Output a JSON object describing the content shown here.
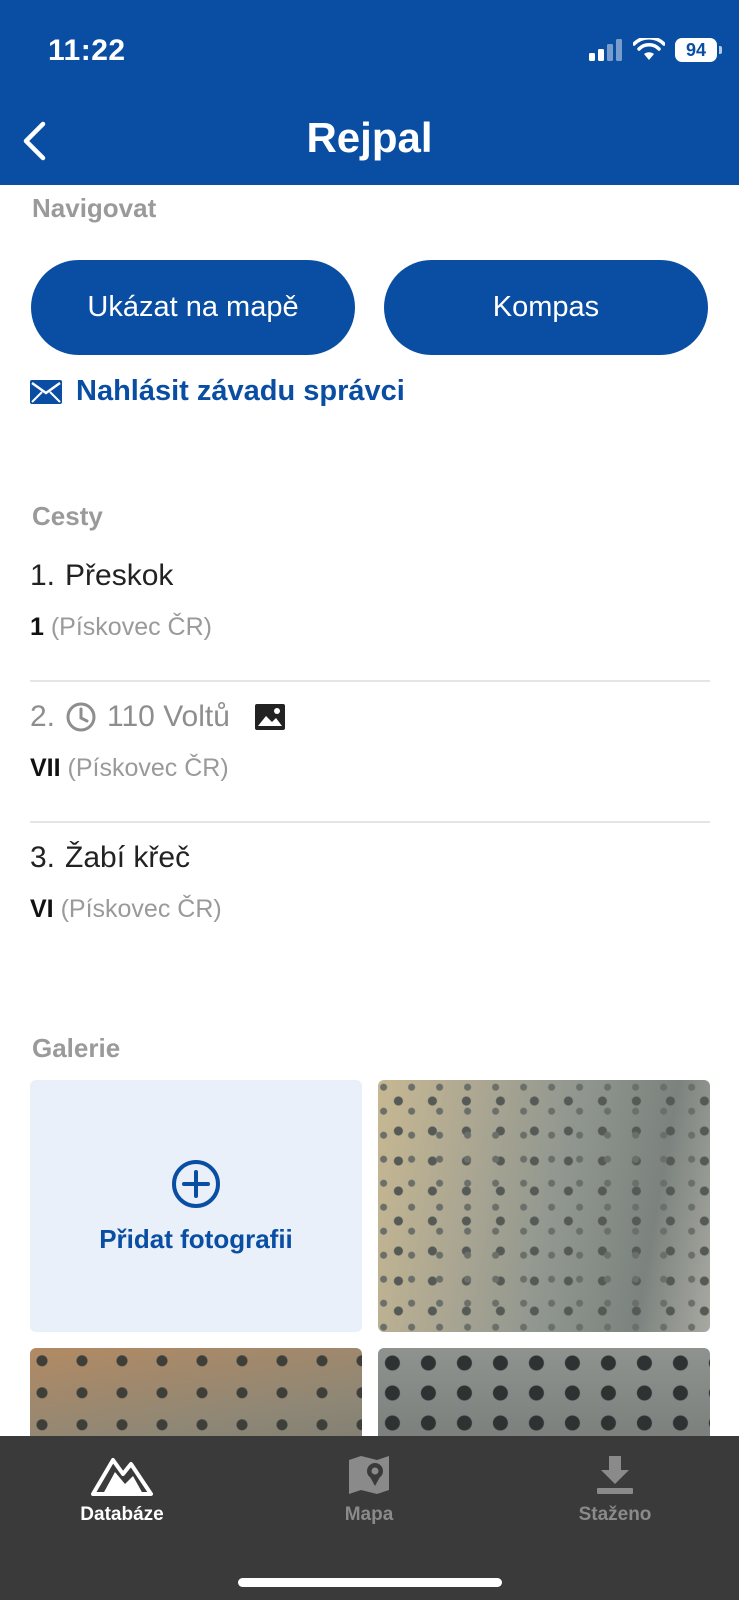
{
  "status_bar": {
    "time": "11:22",
    "battery": "94"
  },
  "header": {
    "title": "Rejpal"
  },
  "navigate": {
    "section_label": "Navigovat",
    "map_button": "Ukázat na mapě",
    "compass_button": "Kompas",
    "report_link": "Nahlásit závadu správci"
  },
  "routes": {
    "section_label": "Cesty",
    "items": [
      {
        "number": "1.",
        "name": "Přeskok",
        "grade": "1",
        "grade_system": "(Pískovec ČR)",
        "has_clock": false,
        "has_photo": false
      },
      {
        "number": "2.",
        "name": "110 Voltů",
        "grade": "VII",
        "grade_system": "(Pískovec ČR)",
        "has_clock": true,
        "has_photo": true
      },
      {
        "number": "3.",
        "name": "Žabí křeč",
        "grade": "VI",
        "grade_system": "(Pískovec ČR)",
        "has_clock": false,
        "has_photo": false
      }
    ]
  },
  "gallery": {
    "section_label": "Galerie",
    "add_label": "Přidat fotografii"
  },
  "tabs": [
    {
      "label": "Databáze",
      "icon": "mountain-icon",
      "active": true
    },
    {
      "label": "Mapa",
      "icon": "map-icon",
      "active": false
    },
    {
      "label": "Staženo",
      "icon": "download-icon",
      "active": false
    }
  ],
  "colors": {
    "primary": "#0a4ea3",
    "tabbar": "#3a3a3a"
  }
}
